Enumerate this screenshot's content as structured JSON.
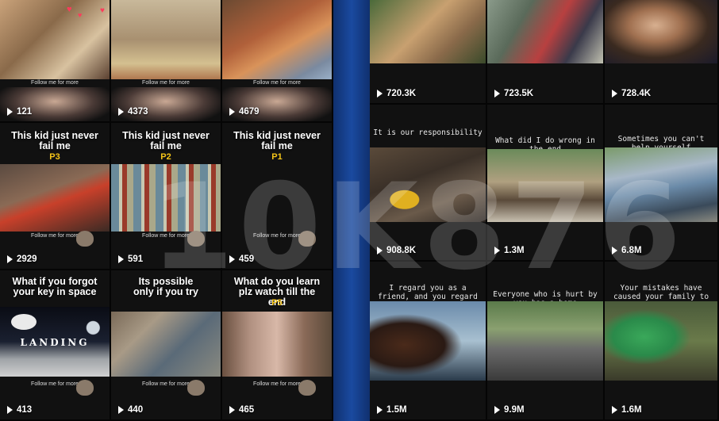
{
  "left_grid": {
    "tiles": [
      {
        "views": "121",
        "follow": "Follow me for more"
      },
      {
        "views": "4373",
        "follow": "Follow me for more"
      },
      {
        "views": "4679",
        "follow": "Follow me for more"
      },
      {
        "title": "This kid just never fail me",
        "part": "P3",
        "views": "2929",
        "follow": "Follow me for more"
      },
      {
        "title": "This kid just never fail me",
        "part": "P2",
        "views": "591",
        "follow": "Follow me for more"
      },
      {
        "title": "This kid just never fail me",
        "part": "P1",
        "views": "459",
        "follow": "Follow me for more"
      },
      {
        "title": "What if you forgot your key in space",
        "views": "413",
        "follow": "Follow me for more",
        "overlay": "LANDING"
      },
      {
        "title": "Its possible only if you try",
        "views": "440",
        "follow": "Follow me for more"
      },
      {
        "title": "What do you learn plz watch till the end",
        "part": "P5",
        "views": "465",
        "follow": "Follow me for more"
      }
    ]
  },
  "right_grid": {
    "tiles": [
      {
        "views": "720.3K"
      },
      {
        "views": "723.5K"
      },
      {
        "views": "728.4K"
      },
      {
        "title": "It is our responsibility",
        "views": "908.8K"
      },
      {
        "title": "What did I do wrong in the end",
        "views": "1.3M"
      },
      {
        "title": "Sometimes you can't help yourself",
        "views": "6.8M"
      },
      {
        "title": "I regard you as a friend, and you regard me as an enemy",
        "views": "1.5M"
      },
      {
        "title": "Everyone who is hurt by you has a home",
        "views": "9.9M"
      },
      {
        "title": "Your mistakes have caused your family to worry",
        "views": "1.6M"
      }
    ]
  },
  "watermark": "10K876",
  "colors": {
    "part_label": "#f5c518",
    "divider": "#1a4aa0",
    "background": "#0c0c10"
  }
}
